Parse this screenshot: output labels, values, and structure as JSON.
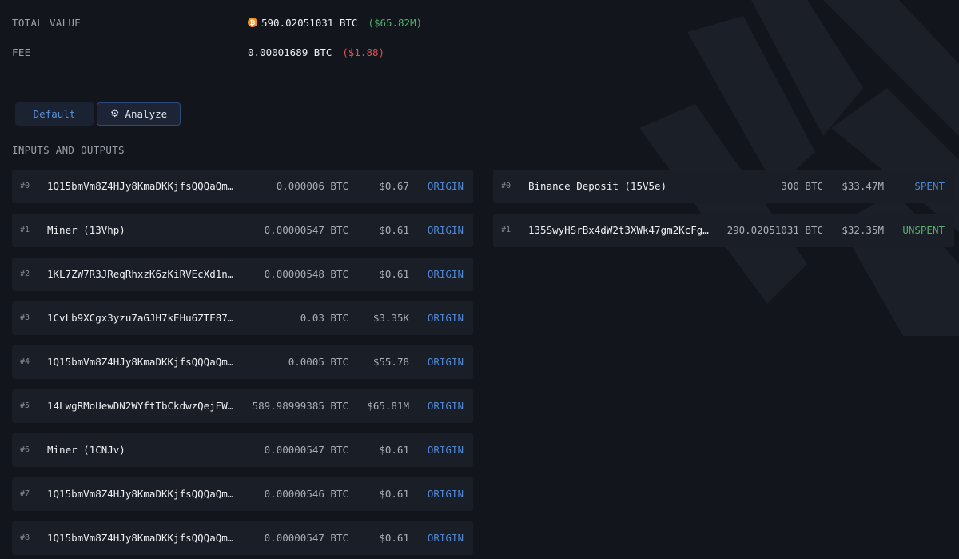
{
  "summary": {
    "total_value_label": "TOTAL VALUE",
    "total_value_btc": "590.02051031 BTC",
    "total_value_usd": "($65.82M)",
    "fee_label": "FEE",
    "fee_btc": "0.00001689 BTC",
    "fee_usd": "($1.88)",
    "btc_icon": "bitcoin-icon"
  },
  "tabs": {
    "default_label": "Default",
    "analyze_label": "Analyze",
    "analyze_icon": "analyze-icon"
  },
  "section_title": "INPUTS AND OUTPUTS",
  "inputs": [
    {
      "index": "#0",
      "address": "1Q15bmVm8Z4HJy8KmaDKKjfsQQQaQmT…",
      "amount": "0.000006 BTC",
      "usd": "$0.67",
      "status": "ORIGIN"
    },
    {
      "index": "#1",
      "address": "Miner (13Vhp)",
      "amount": "0.00000547 BTC",
      "usd": "$0.61",
      "status": "ORIGIN"
    },
    {
      "index": "#2",
      "address": "1KL7ZW7R3JReqRhxzK6zKiRVEcXd1nV…",
      "amount": "0.00000548 BTC",
      "usd": "$0.61",
      "status": "ORIGIN"
    },
    {
      "index": "#3",
      "address": "1CvLb9XCgx3yzu7aGJH7kEHu6ZTE87v…",
      "amount": "0.03 BTC",
      "usd": "$3.35K",
      "status": "ORIGIN"
    },
    {
      "index": "#4",
      "address": "1Q15bmVm8Z4HJy8KmaDKKjfsQQQaQmT…",
      "amount": "0.0005 BTC",
      "usd": "$55.78",
      "status": "ORIGIN"
    },
    {
      "index": "#5",
      "address": "14LwgRMoUewDN2WYftTbCkdwzQejEWw…",
      "amount": "589.98999385 BTC",
      "usd": "$65.81M",
      "status": "ORIGIN"
    },
    {
      "index": "#6",
      "address": "Miner (1CNJv)",
      "amount": "0.00000547 BTC",
      "usd": "$0.61",
      "status": "ORIGIN"
    },
    {
      "index": "#7",
      "address": "1Q15bmVm8Z4HJy8KmaDKKjfsQQQaQmT…",
      "amount": "0.00000546 BTC",
      "usd": "$0.61",
      "status": "ORIGIN"
    },
    {
      "index": "#8",
      "address": "1Q15bmVm8Z4HJy8KmaDKKjfsQQQaQmT…",
      "amount": "0.00000547 BTC",
      "usd": "$0.61",
      "status": "ORIGIN"
    }
  ],
  "outputs": [
    {
      "index": "#0",
      "address": "Binance Deposit (15V5e)",
      "amount": "300 BTC",
      "usd": "$33.47M",
      "status": "SPENT"
    },
    {
      "index": "#1",
      "address": "135SwyHSrBx4dW2t3XWk47gm2KcFgG…",
      "amount": "290.02051031 BTC",
      "usd": "$32.35M",
      "status": "UNSPENT"
    }
  ],
  "colors": {
    "background": "#12151c",
    "row_bg": "#1a1e27",
    "accent_blue": "#4f86d6",
    "green": "#4caf6e",
    "red": "#e05252",
    "bitcoin_orange": "#f7931a"
  }
}
